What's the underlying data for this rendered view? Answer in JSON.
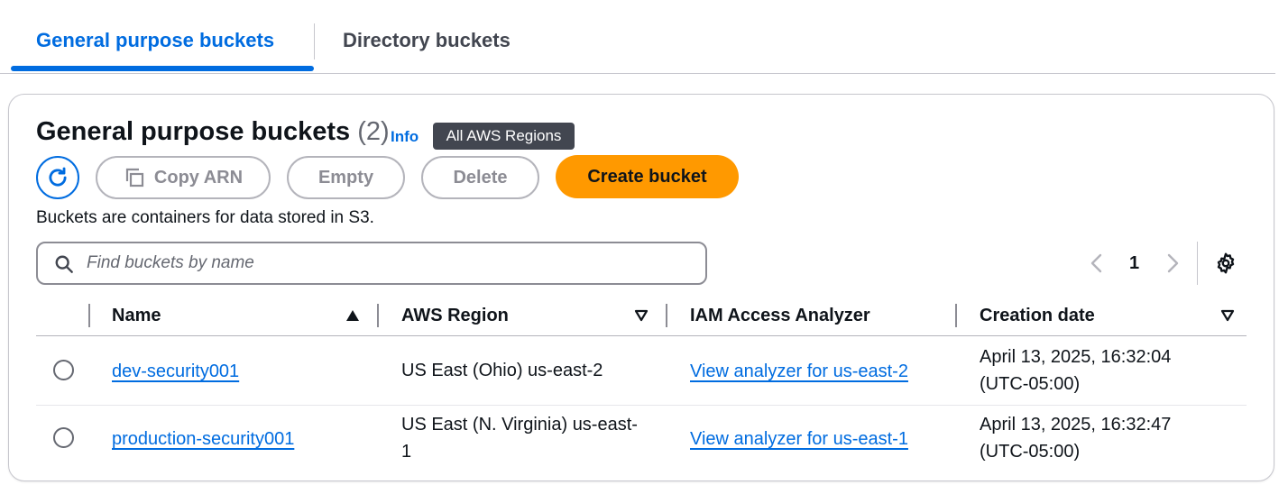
{
  "tabs": [
    {
      "label": "General purpose buckets",
      "active": true
    },
    {
      "label": "Directory buckets",
      "active": false
    }
  ],
  "panel": {
    "title": "General purpose buckets",
    "count": "(2)",
    "info_label": "Info",
    "region_badge": "All AWS Regions",
    "description": "Buckets are containers for data stored in S3."
  },
  "toolbar": {
    "refresh_icon": "refresh-icon",
    "copy_arn_label": "Copy ARN",
    "empty_label": "Empty",
    "delete_label": "Delete",
    "create_label": "Create bucket"
  },
  "search": {
    "placeholder": "Find buckets by name",
    "value": ""
  },
  "pagination": {
    "current_page": "1"
  },
  "table": {
    "columns": [
      {
        "label": "Name",
        "sort": "ascending"
      },
      {
        "label": "AWS Region",
        "sort": "none"
      },
      {
        "label": "IAM Access Analyzer",
        "sort": "none"
      },
      {
        "label": "Creation date",
        "sort": "none"
      }
    ],
    "rows": [
      {
        "name": "dev-security001",
        "region_line1": "US East (Ohio) us-east-2",
        "region_line2": "",
        "analyzer": "View analyzer for us-east-2",
        "date_line1": "April 13, 2025, 16:32:04",
        "date_line2": "(UTC-05:00)"
      },
      {
        "name": "production-security001",
        "region_line1": "US East (N. Virginia) us-east-",
        "region_line2": "1",
        "analyzer": "View analyzer for us-east-1",
        "date_line1": "April 13, 2025, 16:32:47",
        "date_line2": "(UTC-05:00)"
      }
    ]
  },
  "colors": {
    "accent": "#006ce0",
    "primary_button": "#ff9900",
    "badge_bg": "#424650",
    "disabled": "#8c8c94"
  }
}
